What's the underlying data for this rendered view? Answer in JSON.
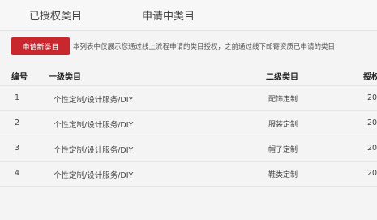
{
  "tabs": [
    {
      "label": "已授权类目"
    },
    {
      "label": "申请中类目"
    }
  ],
  "apply_button": "申请新类目",
  "notice": "本列表中仅展示您通过线上流程申请的类目授权，之前通过线下邮寄资质已申请的类目",
  "table": {
    "headers": {
      "no": "编号",
      "level1": "一级类目",
      "level2": "二级类目",
      "date": "授权"
    },
    "rows": [
      {
        "no": "1",
        "level1": "个性定制/设计服务/DIY",
        "level2": "配饰定制",
        "date": "20"
      },
      {
        "no": "2",
        "level1": "个性定制/设计服务/DIY",
        "level2": "服装定制",
        "date": "20"
      },
      {
        "no": "3",
        "level1": "个性定制/设计服务/DIY",
        "level2": "帽子定制",
        "date": "20"
      },
      {
        "no": "4",
        "level1": "个性定制/设计服务/DIY",
        "level2": "鞋类定制",
        "date": "20"
      }
    ]
  },
  "colors": {
    "accent": "#c8282d"
  }
}
